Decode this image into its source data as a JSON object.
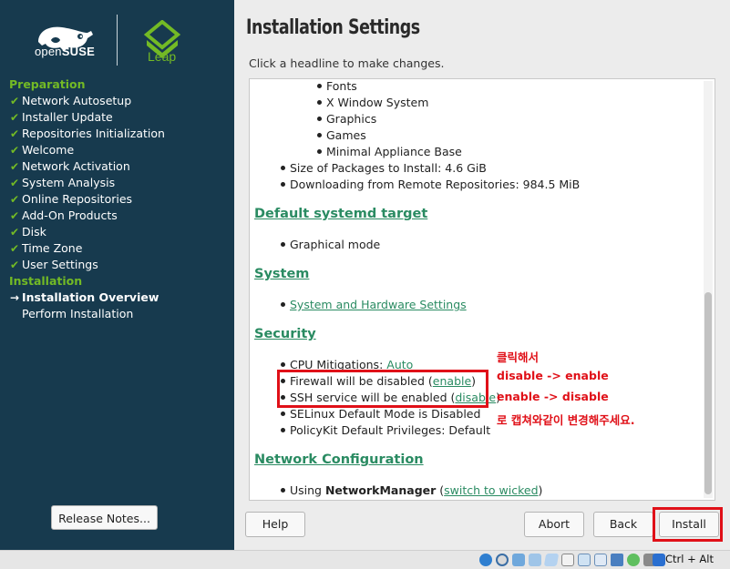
{
  "brand": {
    "suse_prefix": "open",
    "suse_name": "SUSE",
    "edition": "Leap",
    "accent": "#73ba25",
    "sidebar_bg": "#173a4e",
    "link_color": "#2a8b62"
  },
  "sidebar": {
    "groups": [
      {
        "header": "Preparation",
        "items": [
          {
            "label": "Network Autosetup",
            "state": "done"
          },
          {
            "label": "Installer Update",
            "state": "done"
          },
          {
            "label": "Repositories Initialization",
            "state": "done"
          },
          {
            "label": "Welcome",
            "state": "done"
          },
          {
            "label": "Network Activation",
            "state": "done"
          },
          {
            "label": "System Analysis",
            "state": "done"
          },
          {
            "label": "Online Repositories",
            "state": "done"
          },
          {
            "label": "Add-On Products",
            "state": "done"
          },
          {
            "label": "Disk",
            "state": "done"
          },
          {
            "label": "Time Zone",
            "state": "done"
          },
          {
            "label": "User Settings",
            "state": "done"
          }
        ]
      },
      {
        "header": "Installation",
        "items": [
          {
            "label": "Installation Overview",
            "state": "current"
          },
          {
            "label": "Perform Installation",
            "state": "pending"
          }
        ]
      }
    ],
    "release_notes_label": "Release Notes..."
  },
  "main": {
    "title": "Installation Settings",
    "hint": "Click a headline to make changes.",
    "software_items": [
      "Fonts",
      "X Window System",
      "Graphics",
      "Games",
      "Minimal Appliance Base"
    ],
    "package_size": "Size of Packages to Install: 4.6 GiB",
    "download_size": "Downloading from Remote Repositories: 984.5 MiB",
    "sections": {
      "systemd": {
        "title": "Default systemd target",
        "value": "Graphical mode"
      },
      "system": {
        "title": "System",
        "link": "System and Hardware Settings"
      },
      "security": {
        "title": "Security",
        "cpu_label": "CPU Mitigations: ",
        "cpu_link": "Auto",
        "firewall_label": "Firewall will be disabled (",
        "firewall_link": "enable",
        "ssh_label": "SSH service will be enabled (",
        "ssh_link": "disable",
        "close_paren": ")",
        "selinux": "SELinux Default Mode is Disabled",
        "polkit": "PolicyKit Default Privileges: Default"
      },
      "network": {
        "title": "Network Configuration",
        "prefix": "Using ",
        "manager": "NetworkManager",
        "open_paren": " (",
        "link": "switch to wicked",
        "close_paren": ")"
      }
    },
    "annotations": {
      "line1": "클릭해서",
      "line2": "disable -> enable",
      "line3": "enable -> disable",
      "line4": "로 캡쳐와같이 변경해주세요."
    },
    "buttons": {
      "help": "Help",
      "abort": "Abort",
      "back": "Back",
      "install": "Install"
    }
  },
  "taskbar": {
    "host_key": "Ctrl + Alt"
  }
}
